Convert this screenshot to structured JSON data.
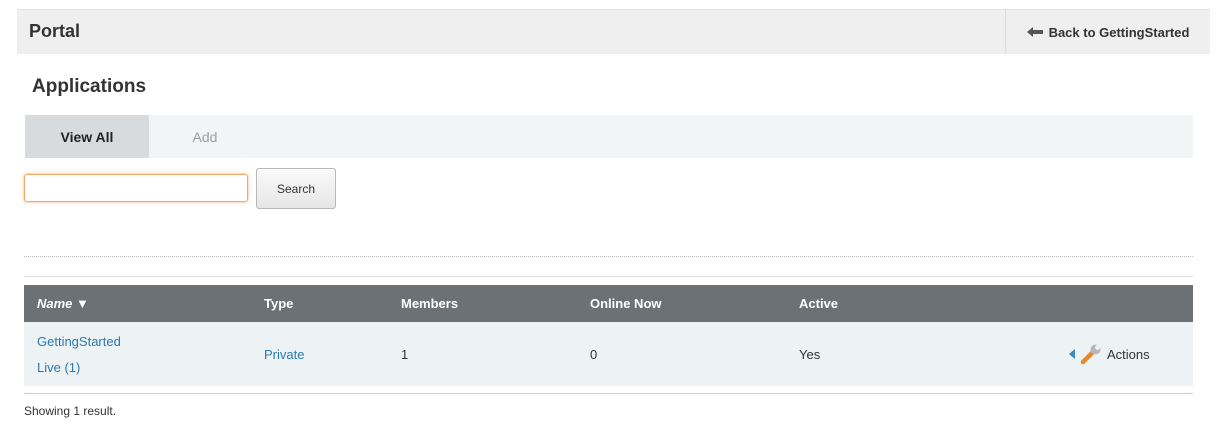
{
  "header": {
    "title": "Portal",
    "back_label": "Back to GettingStarted"
  },
  "section": {
    "title": "Applications"
  },
  "tabs": [
    {
      "label": "View All",
      "active": true
    },
    {
      "label": "Add",
      "active": false
    }
  ],
  "search": {
    "value": "",
    "placeholder": "",
    "button_label": "Search"
  },
  "table": {
    "columns": [
      "Name ▼",
      "Type",
      "Members",
      "Online Now",
      "Active"
    ],
    "rows": [
      {
        "name_line1": "GettingStarted",
        "name_line2": "Live (1)",
        "type": "Private",
        "members": "1",
        "online_now": "0",
        "active": "Yes",
        "actions_label": "Actions"
      }
    ]
  },
  "footer": {
    "result_text": "Showing 1 result."
  },
  "colors": {
    "header_bg": "#6b7174",
    "link": "#2a7ab0",
    "input_focus": "#f0a868"
  }
}
